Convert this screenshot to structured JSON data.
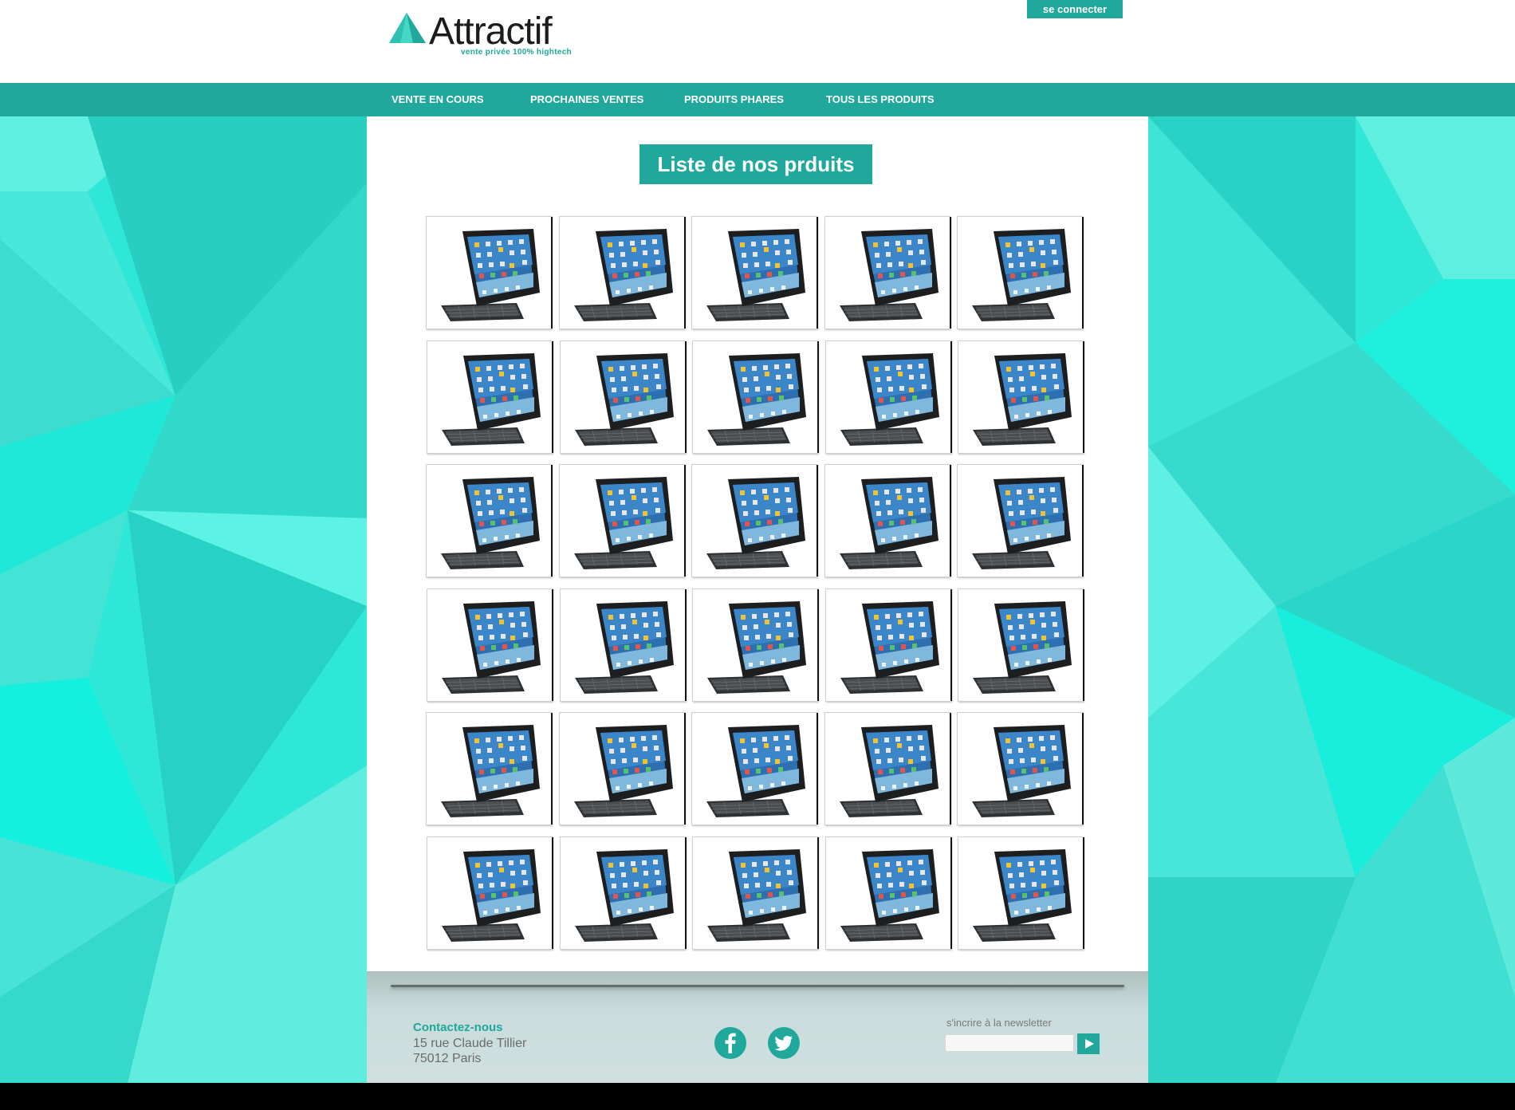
{
  "brand": {
    "name": "Attractif",
    "tagline": "vente privée 100% hightech",
    "accent_color": "#1fa89b",
    "background_color": "#2be6d5"
  },
  "header": {
    "connect_label": "se connecter"
  },
  "nav": {
    "items": [
      {
        "label": "VENTE EN COURS"
      },
      {
        "label": "PROCHAINES VENTES"
      },
      {
        "label": "PRODUITS PHARES"
      },
      {
        "label": "TOUS LES PRODUITS"
      }
    ]
  },
  "main": {
    "title": "Liste de nos prduits",
    "product_image": "ipad-with-black-keyboard-case",
    "grid": {
      "rows": 6,
      "columns": 5
    }
  },
  "footer": {
    "contact_title": "Contactez-nous",
    "address_line1": "15 rue Claude Tillier",
    "address_line2": "75012 Paris",
    "social": [
      {
        "icon": "facebook-icon"
      },
      {
        "icon": "twitter-icon"
      }
    ],
    "newsletter_label": "s'incrire à la newsletter",
    "newsletter_placeholder": "",
    "newsletter_submit_icon": "play-arrow-icon"
  }
}
